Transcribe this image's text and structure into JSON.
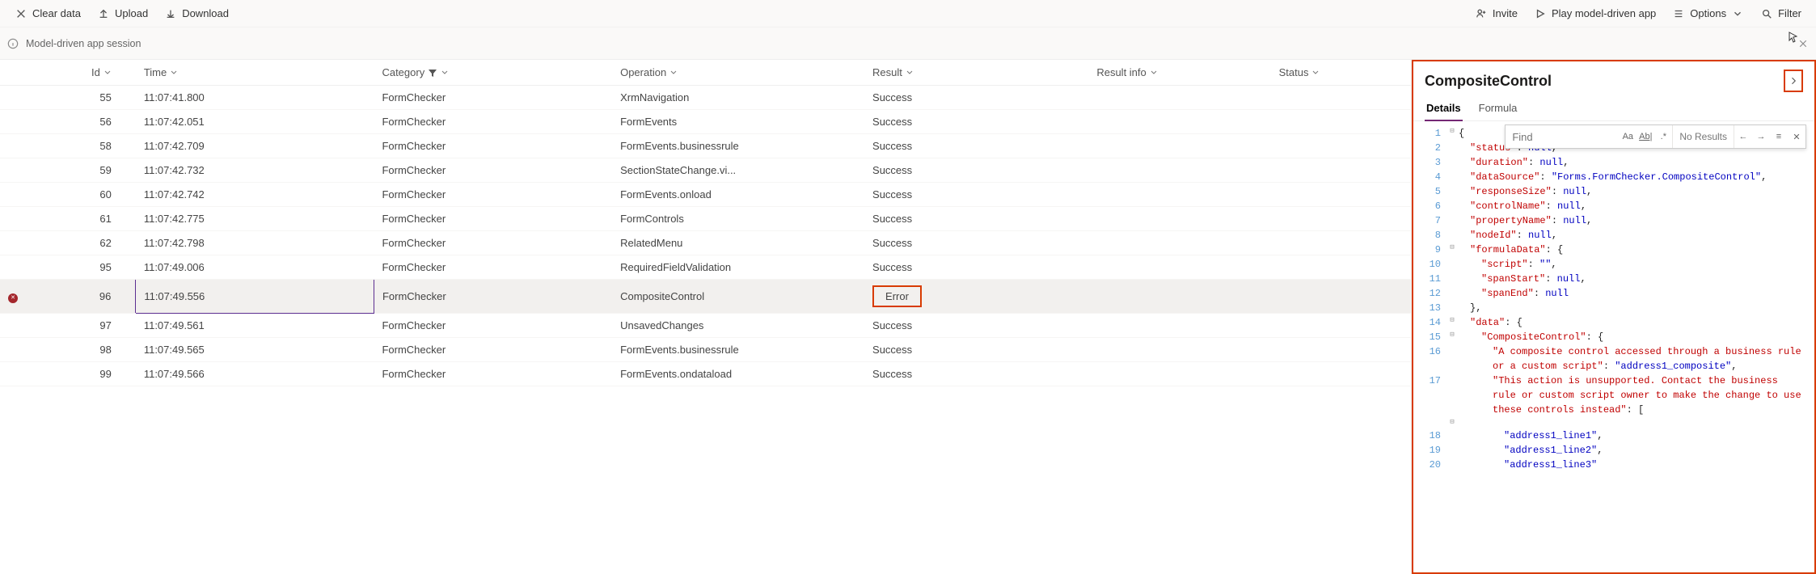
{
  "toolbar": {
    "clear_data": "Clear data",
    "upload": "Upload",
    "download": "Download",
    "invite": "Invite",
    "play": "Play model-driven app",
    "options": "Options",
    "filter": "Filter"
  },
  "session": {
    "label": "Model-driven app session"
  },
  "columns": {
    "id": "Id",
    "time": "Time",
    "category": "Category",
    "operation": "Operation",
    "result": "Result",
    "result_info": "Result info",
    "status": "Status"
  },
  "rows": [
    {
      "id": "55",
      "time": "11:07:41.800",
      "category": "FormChecker",
      "operation": "XrmNavigation",
      "result": "Success",
      "error": false
    },
    {
      "id": "56",
      "time": "11:07:42.051",
      "category": "FormChecker",
      "operation": "FormEvents",
      "result": "Success",
      "error": false
    },
    {
      "id": "58",
      "time": "11:07:42.709",
      "category": "FormChecker",
      "operation": "FormEvents.businessrule",
      "result": "Success",
      "error": false
    },
    {
      "id": "59",
      "time": "11:07:42.732",
      "category": "FormChecker",
      "operation": "SectionStateChange.vi...",
      "result": "Success",
      "error": false
    },
    {
      "id": "60",
      "time": "11:07:42.742",
      "category": "FormChecker",
      "operation": "FormEvents.onload",
      "result": "Success",
      "error": false
    },
    {
      "id": "61",
      "time": "11:07:42.775",
      "category": "FormChecker",
      "operation": "FormControls",
      "result": "Success",
      "error": false
    },
    {
      "id": "62",
      "time": "11:07:42.798",
      "category": "FormChecker",
      "operation": "RelatedMenu",
      "result": "Success",
      "error": false
    },
    {
      "id": "95",
      "time": "11:07:49.006",
      "category": "FormChecker",
      "operation": "RequiredFieldValidation",
      "result": "Success",
      "error": false
    },
    {
      "id": "96",
      "time": "11:07:49.556",
      "category": "FormChecker",
      "operation": "CompositeControl",
      "result": "Error",
      "error": true,
      "selected": true
    },
    {
      "id": "97",
      "time": "11:07:49.561",
      "category": "FormChecker",
      "operation": "UnsavedChanges",
      "result": "Success",
      "error": false
    },
    {
      "id": "98",
      "time": "11:07:49.565",
      "category": "FormChecker",
      "operation": "FormEvents.businessrule",
      "result": "Success",
      "error": false
    },
    {
      "id": "99",
      "time": "11:07:49.566",
      "category": "FormChecker",
      "operation": "FormEvents.ondataload",
      "result": "Success",
      "error": false
    }
  ],
  "panel": {
    "title": "CompositeControl",
    "tabs": {
      "details": "Details",
      "formula": "Formula"
    },
    "find": {
      "placeholder": "Find",
      "no_results": "No Results"
    },
    "code_lines": [
      {
        "n": "1",
        "fold": "⊟",
        "indent": 0,
        "tokens": [
          {
            "t": "punc",
            "v": "{"
          }
        ]
      },
      {
        "n": "2",
        "fold": "",
        "indent": 1,
        "tokens": [
          {
            "t": "key",
            "v": "\"status\""
          },
          {
            "t": "punc",
            "v": ": "
          },
          {
            "t": "null",
            "v": "null"
          },
          {
            "t": "punc",
            "v": ","
          }
        ]
      },
      {
        "n": "3",
        "fold": "",
        "indent": 1,
        "tokens": [
          {
            "t": "key",
            "v": "\"duration\""
          },
          {
            "t": "punc",
            "v": ": "
          },
          {
            "t": "null",
            "v": "null"
          },
          {
            "t": "punc",
            "v": ","
          }
        ]
      },
      {
        "n": "4",
        "fold": "",
        "indent": 1,
        "tokens": [
          {
            "t": "key",
            "v": "\"dataSource\""
          },
          {
            "t": "punc",
            "v": ": "
          },
          {
            "t": "str",
            "v": "\"Forms.FormChecker.CompositeControl\""
          },
          {
            "t": "punc",
            "v": ","
          }
        ]
      },
      {
        "n": "5",
        "fold": "",
        "indent": 1,
        "tokens": [
          {
            "t": "key",
            "v": "\"responseSize\""
          },
          {
            "t": "punc",
            "v": ": "
          },
          {
            "t": "null",
            "v": "null"
          },
          {
            "t": "punc",
            "v": ","
          }
        ]
      },
      {
        "n": "6",
        "fold": "",
        "indent": 1,
        "tokens": [
          {
            "t": "key",
            "v": "\"controlName\""
          },
          {
            "t": "punc",
            "v": ": "
          },
          {
            "t": "null",
            "v": "null"
          },
          {
            "t": "punc",
            "v": ","
          }
        ]
      },
      {
        "n": "7",
        "fold": "",
        "indent": 1,
        "tokens": [
          {
            "t": "key",
            "v": "\"propertyName\""
          },
          {
            "t": "punc",
            "v": ": "
          },
          {
            "t": "null",
            "v": "null"
          },
          {
            "t": "punc",
            "v": ","
          }
        ]
      },
      {
        "n": "8",
        "fold": "",
        "indent": 1,
        "tokens": [
          {
            "t": "key",
            "v": "\"nodeId\""
          },
          {
            "t": "punc",
            "v": ": "
          },
          {
            "t": "null",
            "v": "null"
          },
          {
            "t": "punc",
            "v": ","
          }
        ]
      },
      {
        "n": "9",
        "fold": "⊟",
        "indent": 1,
        "tokens": [
          {
            "t": "key",
            "v": "\"formulaData\""
          },
          {
            "t": "punc",
            "v": ": {"
          }
        ]
      },
      {
        "n": "10",
        "fold": "",
        "indent": 2,
        "tokens": [
          {
            "t": "key",
            "v": "\"script\""
          },
          {
            "t": "punc",
            "v": ": "
          },
          {
            "t": "str",
            "v": "\"\""
          },
          {
            "t": "punc",
            "v": ","
          }
        ]
      },
      {
        "n": "11",
        "fold": "",
        "indent": 2,
        "tokens": [
          {
            "t": "key",
            "v": "\"spanStart\""
          },
          {
            "t": "punc",
            "v": ": "
          },
          {
            "t": "null",
            "v": "null"
          },
          {
            "t": "punc",
            "v": ","
          }
        ]
      },
      {
        "n": "12",
        "fold": "",
        "indent": 2,
        "tokens": [
          {
            "t": "key",
            "v": "\"spanEnd\""
          },
          {
            "t": "punc",
            "v": ": "
          },
          {
            "t": "null",
            "v": "null"
          }
        ]
      },
      {
        "n": "13",
        "fold": "",
        "indent": 1,
        "tokens": [
          {
            "t": "punc",
            "v": "},"
          }
        ]
      },
      {
        "n": "14",
        "fold": "⊟",
        "indent": 1,
        "tokens": [
          {
            "t": "key",
            "v": "\"data\""
          },
          {
            "t": "punc",
            "v": ": {"
          }
        ]
      },
      {
        "n": "15",
        "fold": "⊟",
        "indent": 2,
        "tokens": [
          {
            "t": "key",
            "v": "\"CompositeControl\""
          },
          {
            "t": "punc",
            "v": ": {"
          }
        ]
      },
      {
        "n": "16",
        "fold": "",
        "indent": 3,
        "tokens": [
          {
            "t": "key",
            "v": "\"A composite control accessed through a business rule or a custom script\""
          },
          {
            "t": "punc",
            "v": ": "
          },
          {
            "t": "str",
            "v": "\"address1_composite\""
          },
          {
            "t": "punc",
            "v": ","
          }
        ]
      },
      {
        "n": "17",
        "fold": "",
        "indent": 3,
        "tokens": [
          {
            "t": "key",
            "v": "\"This action is unsupported. Contact the business rule or custom script owner to make the change to use these controls instead\""
          },
          {
            "t": "punc",
            "v": ": ["
          }
        ]
      },
      {
        "n": "",
        "fold": "⊟",
        "indent": 3,
        "tokens": []
      },
      {
        "n": "18",
        "fold": "",
        "indent": 4,
        "tokens": [
          {
            "t": "str",
            "v": "\"address1_line1\""
          },
          {
            "t": "punc",
            "v": ","
          }
        ]
      },
      {
        "n": "19",
        "fold": "",
        "indent": 4,
        "tokens": [
          {
            "t": "str",
            "v": "\"address1_line2\""
          },
          {
            "t": "punc",
            "v": ","
          }
        ]
      },
      {
        "n": "20",
        "fold": "",
        "indent": 4,
        "tokens": [
          {
            "t": "str",
            "v": "\"address1_line3\""
          }
        ]
      }
    ]
  }
}
